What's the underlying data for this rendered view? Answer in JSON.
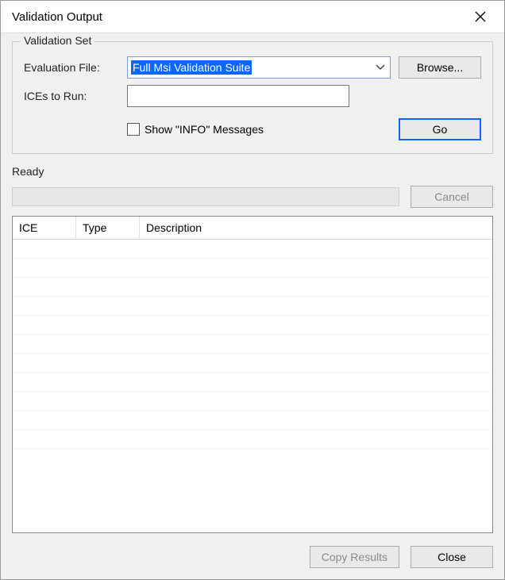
{
  "window": {
    "title": "Validation Output"
  },
  "fieldset": {
    "legend": "Validation Set",
    "eval_label": "Evaluation File:",
    "eval_value": "Full Msi Validation Suite",
    "browse_label": "Browse...",
    "ices_label": "ICEs to Run:",
    "ices_value": "",
    "show_info_label": "Show \"INFO\" Messages",
    "show_info_checked": false,
    "go_label": "Go"
  },
  "status": {
    "text": "Ready",
    "cancel_label": "Cancel"
  },
  "table": {
    "columns": {
      "ice": "ICE",
      "type": "Type",
      "description": "Description"
    },
    "rows": []
  },
  "footer": {
    "copy_label": "Copy Results",
    "close_label": "Close"
  }
}
